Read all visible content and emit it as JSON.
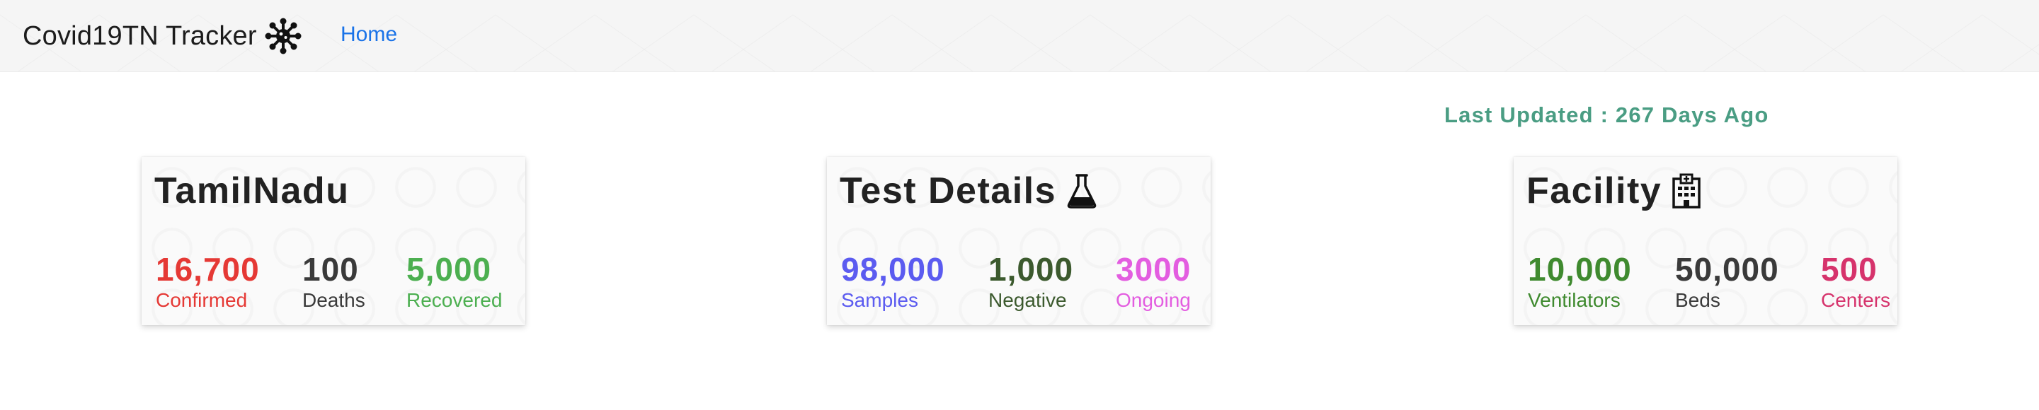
{
  "navbar": {
    "brand": "Covid19TN Tracker",
    "home_link": "Home"
  },
  "last_updated": "Last Updated : 267 Days Ago",
  "cards": [
    {
      "title": "TamilNadu",
      "icon": "none",
      "stats": [
        {
          "value": "16,700",
          "label": "Confirmed",
          "color": "#e53935"
        },
        {
          "value": "100",
          "label": "Deaths",
          "color": "#3a3a3a"
        },
        {
          "value": "5,000",
          "label": "Recovered",
          "color": "#4caf50"
        }
      ]
    },
    {
      "title": "Test Details",
      "icon": "flask-icon",
      "stats": [
        {
          "value": "98,000",
          "label": "Samples",
          "color": "#5b5bf0"
        },
        {
          "value": "1,000",
          "label": "Negative",
          "color": "#3c5a2e"
        },
        {
          "value": "3000",
          "label": "Ongoing",
          "color": "#e35de0"
        }
      ]
    },
    {
      "title": "Facility",
      "icon": "hospital-icon",
      "stats": [
        {
          "value": "10,000",
          "label": "Ventilators",
          "color": "#3f8a2f"
        },
        {
          "value": "50,000",
          "label": "Beds",
          "color": "#3a3a3a"
        },
        {
          "value": "500",
          "label": "Centers",
          "color": "#d6336c"
        }
      ]
    }
  ]
}
